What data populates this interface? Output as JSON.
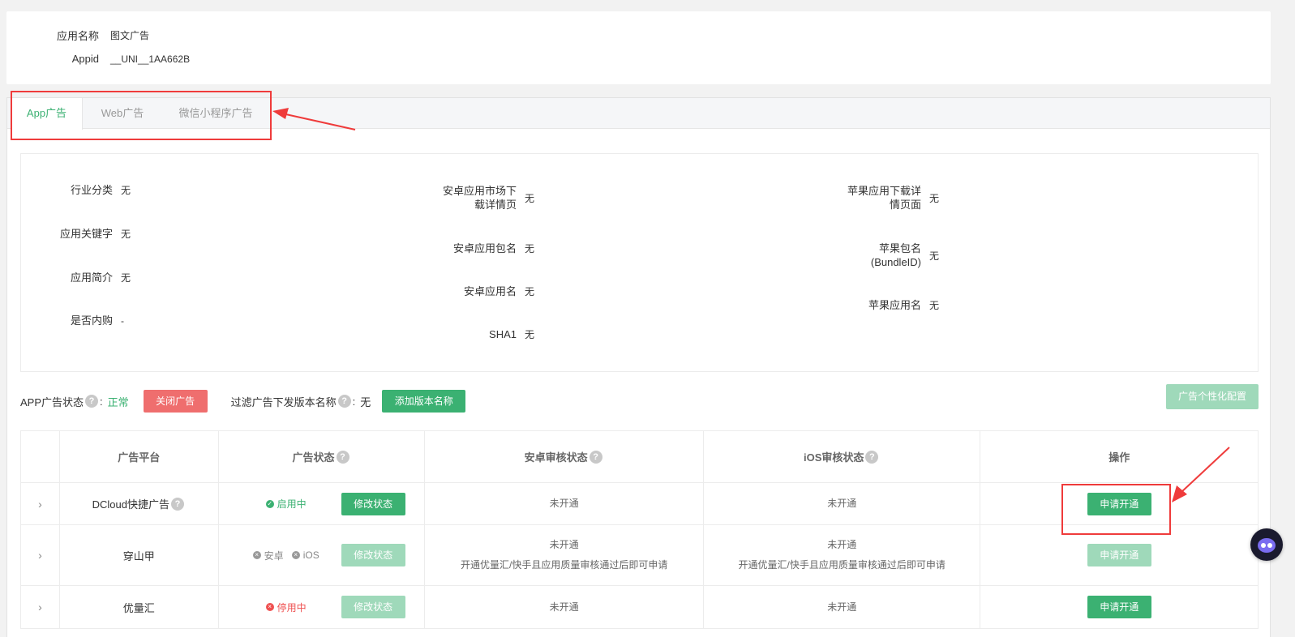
{
  "app_info": {
    "name_label": "应用名称",
    "name_value": "图文广告",
    "appid_label": "Appid",
    "appid_value": "__UNI__1AA662B"
  },
  "tabs": [
    {
      "label": "App广告",
      "active": true
    },
    {
      "label": "Web广告",
      "active": false
    },
    {
      "label": "微信小程序广告",
      "active": false
    }
  ],
  "fields": {
    "col1": [
      {
        "label": "行业分类",
        "value": "无"
      },
      {
        "label": "应用关键字",
        "value": "无"
      },
      {
        "label": "应用简介",
        "value": "无"
      },
      {
        "label": "是否内购",
        "value": "-"
      }
    ],
    "col2": [
      {
        "label_line1": "安卓应用市场下",
        "label_line2": "载详情页",
        "value": "无"
      },
      {
        "label": "安卓应用包名",
        "value": "无"
      },
      {
        "label": "安卓应用名",
        "value": "无"
      },
      {
        "label": "SHA1",
        "value": "无"
      }
    ],
    "col3": [
      {
        "label_line1": "苹果应用下载详",
        "label_line2": "情页面",
        "value": "无"
      },
      {
        "label_line1": "苹果包名",
        "label_line2": "(BundleID)",
        "value": "无"
      },
      {
        "label": "苹果应用名",
        "value": "无"
      }
    ]
  },
  "status_bar": {
    "ad_status_label": "APP广告状态",
    "colon": ":",
    "ad_status_value": "正常",
    "close_btn": "关闭广告",
    "filter_label": "过滤广告下发版本名称",
    "filter_value": "无",
    "add_btn": "添加版本名称",
    "personalize_btn": "广告个性化配置"
  },
  "table": {
    "headers": [
      "广告平台",
      "广告状态",
      "安卓审核状态",
      "iOS审核状态",
      "操作"
    ],
    "rows": [
      {
        "platform": "DCloud快捷广告",
        "status": "启用中",
        "modify_btn": "修改状态",
        "android": "未开通",
        "ios": "未开通",
        "action": "申请开通"
      },
      {
        "platform": "穿山甲",
        "status_android": "安卓",
        "status_ios": "iOS",
        "modify_btn": "修改状态",
        "android": "未开通",
        "android_note": "开通优量汇/快手且应用质量审核通过后即可申请",
        "ios": "未开通",
        "ios_note": "开通优量汇/快手且应用质量审核通过后即可申请",
        "action": "申请开通"
      },
      {
        "platform": "优量汇",
        "status": "停用中",
        "modify_btn": "修改状态",
        "android": "未开通",
        "ios": "未开通",
        "action": "申请开通"
      }
    ]
  },
  "icons": {
    "expand": "chevron-right-icon",
    "help": "question-icon",
    "enabled": "check-circle-icon",
    "disabled": "x-circle-icon"
  },
  "colors": {
    "accent_green": "#3bb172",
    "danger_red": "#ef6e6e",
    "annotation_red": "#ef3b3b"
  }
}
